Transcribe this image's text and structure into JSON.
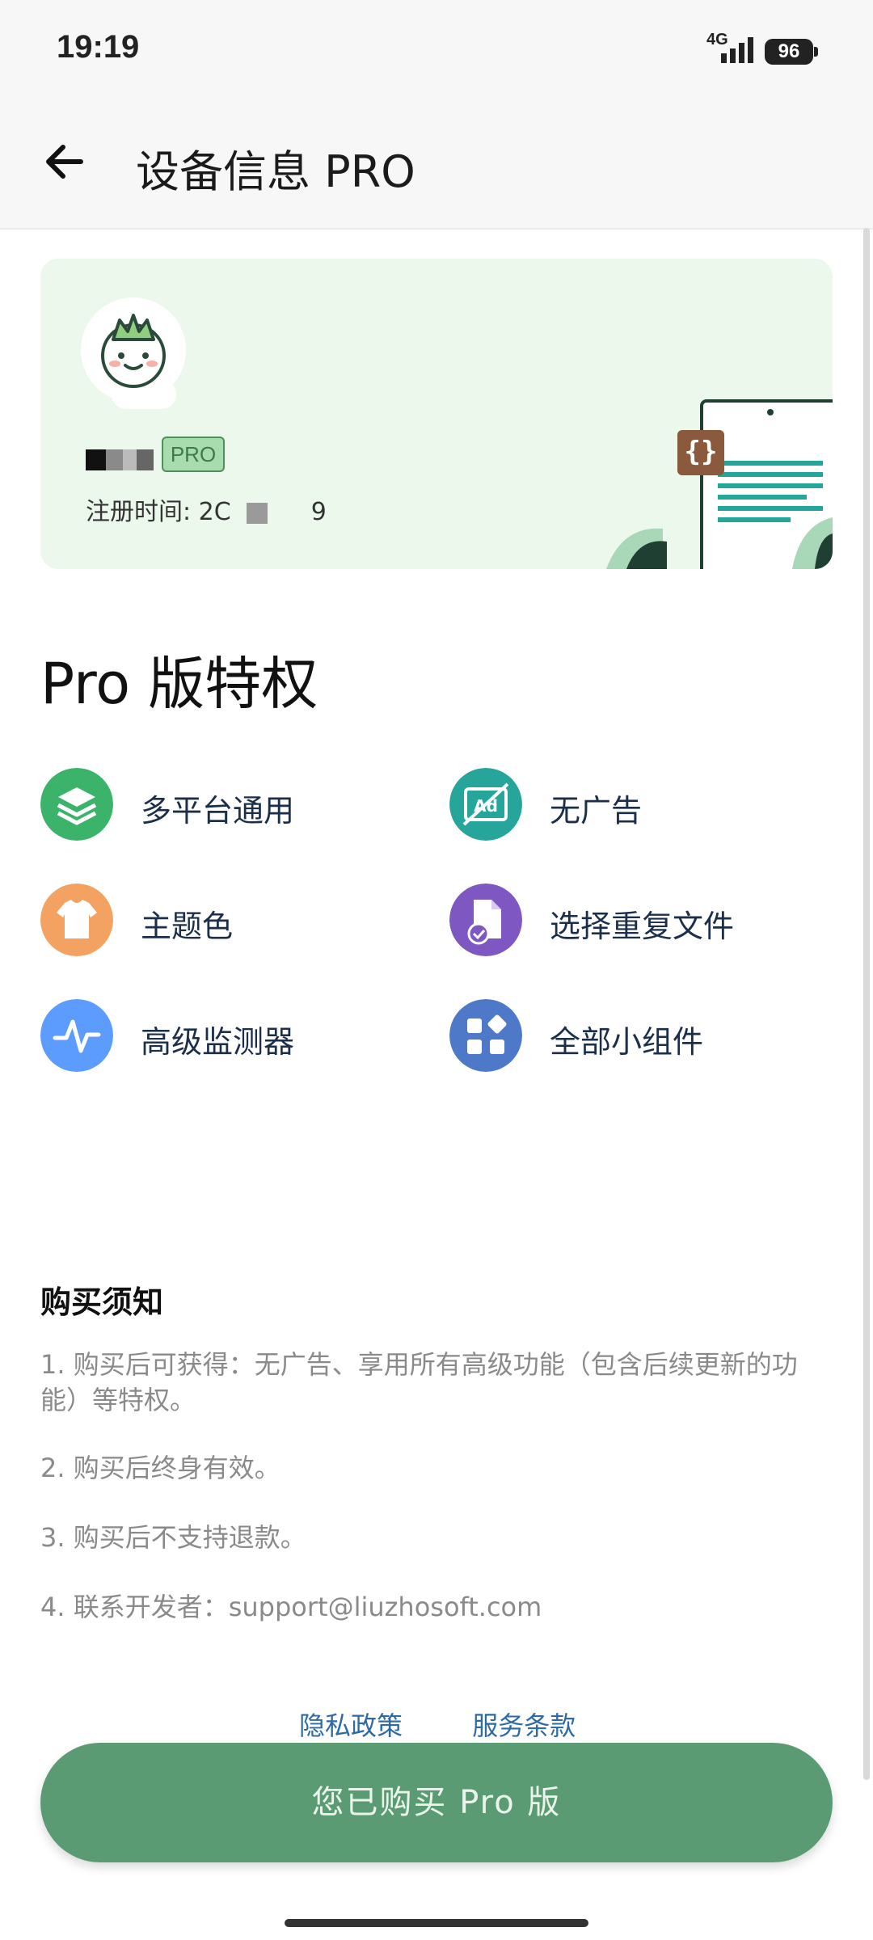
{
  "status": {
    "time": "19:19",
    "network": "4G",
    "battery": "96"
  },
  "appbar": {
    "title": "设备信息 PRO",
    "back_icon": "arrow-left-icon"
  },
  "profile": {
    "badge": "PRO",
    "register_time": "注册时间: 2C",
    "register_suffix": "9"
  },
  "features_title": "Pro 版特权",
  "features": [
    {
      "label": "多平台通用",
      "icon": "layers-icon",
      "color": "#3bb36a"
    },
    {
      "label": "无广告",
      "icon": "no-ad-icon",
      "color": "#26a69a"
    },
    {
      "label": "主题色",
      "icon": "tshirt-icon",
      "color": "#f4a261"
    },
    {
      "label": "选择重复文件",
      "icon": "duplicate-file-icon",
      "color": "#7e57c2"
    },
    {
      "label": "高级监测器",
      "icon": "pulse-icon",
      "color": "#5c9cff"
    },
    {
      "label": "全部小组件",
      "icon": "widgets-icon",
      "color": "#4e79c9"
    }
  ],
  "notice": {
    "title": "购买须知",
    "items": [
      "1. 购买后可获得：无广告、享用所有高级功能（包含后续更新的功能）等特权。",
      "2. 购买后终身有效。",
      "3. 购买后不支持退款。",
      "4. 联系开发者：support@liuzhosoft.com"
    ]
  },
  "links": {
    "privacy": "隐私政策",
    "terms": "服务条款"
  },
  "buy_button": "您已购买 Pro 版"
}
